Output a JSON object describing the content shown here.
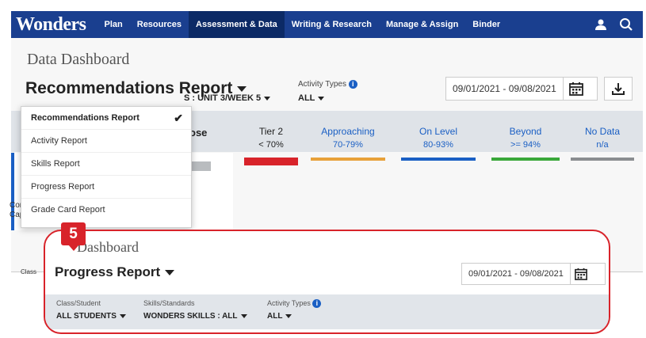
{
  "nav": {
    "logo": "Wonders",
    "items": [
      "Plan",
      "Resources",
      "Assessment & Data",
      "Writing & Research",
      "Manage & Assign",
      "Binder"
    ],
    "active_index": 2,
    "icons": [
      "user-icon",
      "search-icon"
    ]
  },
  "bg": {
    "page_title": "Data Dashboard",
    "report_title": "Recommendations Report",
    "date_range": "09/01/2021 - 09/08/2021",
    "skills_value": "S : UNIT 3/WEEK 5",
    "activity_label": "Activity Types",
    "activity_value": "ALL",
    "card_text": "ose",
    "side_text_1": "Com",
    "side_text_2": "Capt",
    "side_text_3": "Class",
    "tiers": [
      {
        "name": "Tier 2",
        "range": "< 70%",
        "color": "#d8232a"
      },
      {
        "name": "Approaching",
        "range": "70-79%",
        "color": "#e8a13a"
      },
      {
        "name": "On Level",
        "range": "80-93%",
        "color": "#1a5fc4"
      },
      {
        "name": "Beyond",
        "range": ">= 94%",
        "color": "#3aa83a"
      },
      {
        "name": "No Data",
        "range": "n/a",
        "color": "#8a8d90"
      }
    ]
  },
  "menu": {
    "items": [
      "Recommendations Report",
      "Activity Report",
      "Skills Report",
      "Progress Report",
      "Grade Card Report"
    ],
    "selected_index": 0
  },
  "zoom": {
    "badge": "5",
    "page_title": "Dashboard",
    "report_title": "Progress Report",
    "date_range": "09/01/2021 - 09/08/2021",
    "filters": [
      {
        "label": "Class/Student",
        "value": "ALL STUDENTS"
      },
      {
        "label": "Skills/Standards",
        "value": "WONDERS SKILLS : ALL"
      },
      {
        "label": "Activity Types",
        "value": "ALL"
      }
    ]
  },
  "colors": {
    "nav": "#1a3f8f",
    "accent_red": "#d8232a",
    "accent_blue": "#1a5fc4"
  }
}
